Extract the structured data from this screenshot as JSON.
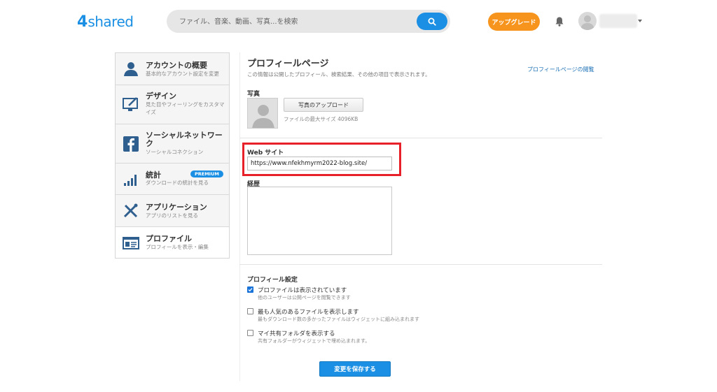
{
  "header": {
    "logo_num": "4",
    "logo_text": "shared",
    "search_placeholder": "ファイル、音楽、動画、写真...を検索",
    "upgrade_label": "アップグレード"
  },
  "sidebar": {
    "items": [
      {
        "title": "アカウントの概要",
        "sub": "基本的なアカウント設定を変更"
      },
      {
        "title": "デザイン",
        "sub": "見た目やフィーリングをカスタマイズ"
      },
      {
        "title": "ソーシャルネットワーク",
        "sub": "ソーシャルコネクション"
      },
      {
        "title": "統計",
        "sub": "ダウンロードの統計を見る",
        "badge": "PREMIUM"
      },
      {
        "title": "アプリケーション",
        "sub": "アプリのリストを見る"
      },
      {
        "title": "プロファイル",
        "sub": "プロフィールを表示・編集"
      }
    ]
  },
  "main": {
    "title": "プロフィールページ",
    "description": "この情報は公開したプロフィール、検索結果、その他の項目で表示されます。",
    "view_link": "プロフィールページの閲覧",
    "photo_label": "写真",
    "upload_button": "写真のアップロード",
    "file_max": "ファイルの最大サイズ 4096KB",
    "website_label": "Web サイト",
    "website_value": "https://www.nfekhmyrm2022-blog.site/",
    "bio_label": "経歴",
    "settings_title": "プロフィール設定",
    "settings": [
      {
        "label": "プロファイルは表示されています",
        "sub": "他のユーザーは公開ページを閲覧できます",
        "checked": true
      },
      {
        "label": "最も人気のあるファイルを表示します",
        "sub": "最もダウンロード数の多かったファイルはウィジェットに組み込まれます",
        "checked": false
      },
      {
        "label": "マイ共有フォルダを表示する",
        "sub": "共有フォルダーがウィジェットで埋め込まれます。",
        "checked": false
      }
    ],
    "save_button": "変更を保存する"
  },
  "colors": {
    "brand": "#1a8fe3",
    "upgrade": "#f7941d",
    "highlight": "#e8202a"
  }
}
